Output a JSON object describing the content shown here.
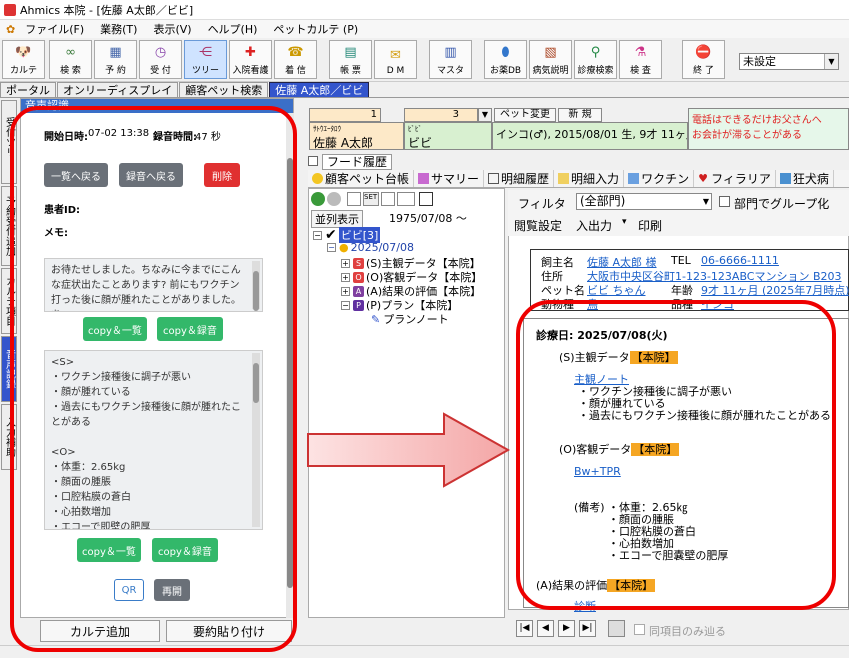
{
  "window": {
    "title": "Ahmics 本院 - [佐藤 A太郎／ビビ]"
  },
  "menu": [
    "ファイル(F)",
    "業務(T)",
    "表示(V)",
    "ヘルプ(H)",
    "ペットカルテ (P)"
  ],
  "toolbar": {
    "buttons": [
      {
        "label": "カルテ",
        "icon": "dog-face-icon"
      },
      {
        "label": "検 索",
        "icon": "binoculars-icon"
      },
      {
        "label": "予 約",
        "icon": "calendar-icon"
      },
      {
        "label": "受 付",
        "icon": "clock-icon"
      },
      {
        "label": "ツリー",
        "icon": "tree-icon"
      },
      {
        "label": "入院看護",
        "icon": "medical-cross-icon"
      },
      {
        "label": "着 信",
        "icon": "phone-bell-icon"
      },
      {
        "label": "帳 票",
        "icon": "document-icon"
      },
      {
        "label": "D M",
        "icon": "envelope-icon"
      },
      {
        "label": "マスタ",
        "icon": "database-icon"
      },
      {
        "label": "お薬DB",
        "icon": "pill-icon"
      },
      {
        "label": "病気説明",
        "icon": "clipboard-icon"
      },
      {
        "label": "診療検索",
        "icon": "magnifier-icon"
      },
      {
        "label": "検 査",
        "icon": "lab-icon"
      },
      {
        "label": "終 了",
        "icon": "stop-icon"
      }
    ],
    "setting_select": "未設定"
  },
  "tabs": [
    "ポータル",
    "オンリーディスプレイ",
    "顧客ペット検索",
    "佐藤 A太郎／ビビ"
  ],
  "side_tabs": [
    "受付ツリー",
    "予約受付追加",
    "カルテ項目",
    "音声記録",
    "入力補助"
  ],
  "voice_panel": {
    "header": "音声認識",
    "start_label": "開始日時:",
    "start_value": "07-02 13:38",
    "duration_label": "録音時間:",
    "duration_value": "47 秒",
    "btn_back_list": "一覧へ戻る",
    "btn_back_rec": "録音へ戻る",
    "btn_delete": "削除",
    "patient_id_label": "患者ID:",
    "memo_label": "メモ:",
    "transcript": "お待たせしました。ちなみに今までにこんな症状出たことあります? 前にもワクチン打った後に顔が腫れたことがありました。あ",
    "btn_copy_list": "copy＆一覧",
    "btn_copy_rec": "copy＆録音",
    "soap_lines": [
      "<S>",
      "・ワクチン接種後に調子が悪い",
      "・顔が腫れている",
      "・過去にもワクチン接種後に顔が腫れたことがある",
      "",
      "<O>",
      "・体重：2.65kg",
      "・顔面の腫脹",
      "・口腔粘膜の蒼白",
      "・心拍数増加",
      "・エコーで即壁の肥厚"
    ],
    "btn_copy_list2": "copy＆一覧",
    "btn_copy_rec2": "copy＆録音",
    "btn_qr": "QR",
    "btn_resume": "再開",
    "btn_add_karte": "カルテ追加",
    "btn_paste_summary": "要約貼り付け"
  },
  "patient": {
    "num1": "1",
    "num3": "3",
    "pet_change": "ペット変更",
    "new": "新 規",
    "kana_owner": "ｻﾄｳｴｰﾀﾛｳ",
    "owner": "佐藤 A太郎",
    "kana_pet": "ﾋﾞﾋﾞ",
    "pet": "ビビ",
    "pet_info": "インコ(♂), 2015/08/01 生, 9才 11ヶ月",
    "note_line1": "電話はできるだけお父さんへ",
    "note_line2": "お会計が滞ることがある"
  },
  "nav_title": "フード履歴",
  "subtabs": [
    "顧客ペット台帳",
    "サマリー",
    "明細履歴",
    "明細入力",
    "ワクチン",
    "フィラリア",
    "狂犬病"
  ],
  "tree": {
    "mode": "並列表示",
    "date_filter": "1975/07/08 〜",
    "root": "ビビ[3]",
    "date": "2025/07/08",
    "items": [
      {
        "tag": "S",
        "label": "(S)主観データ【本院】",
        "color": "#e04040"
      },
      {
        "tag": "O",
        "label": "(O)客観データ【本院】",
        "color": "#e04040"
      },
      {
        "tag": "A",
        "label": "(A)結果の評価【本院】",
        "color": "#8040a0"
      },
      {
        "tag": "P",
        "label": "(P)プラン【本院】",
        "color": "#6030a0"
      }
    ],
    "plan_note": "プランノート"
  },
  "report": {
    "filter_label": "フィルタ",
    "filter_value": "(全部門)",
    "group_label": "部門でグループ化",
    "menu": [
      "閲覧設定",
      "入出力",
      "印刷"
    ],
    "owner_label": "飼主名",
    "owner_value": "佐藤 A太郎 様",
    "tel_label": "TEL",
    "tel_value": "06-6666-1111",
    "addr_label": "住所",
    "addr_value": "大阪市中央区谷町1-123-123ABCマンション B203",
    "pet_label": "ペット名",
    "pet_value": "ビビ ちゃん",
    "age_label": "年齢",
    "age_value": "9才 11ヶ月 (2025年7月時点)",
    "species_label": "動物種",
    "species_value": "鳥",
    "breed_label": "品種",
    "breed_value": "インコ",
    "visit": "診療日: 2025/07/08(火)",
    "s_title": "(S)主観データ",
    "s_badge": "【本院】",
    "s_link": "主観ノート",
    "s_lines": [
      "・ワクチン接種後に調子が悪い",
      "・顔が腫れている",
      "・過去にもワクチン接種後に顔が腫れたことがある"
    ],
    "o_title": "(O)客観データ",
    "o_badge": "【本院】",
    "o_link": "Bw+TPR",
    "o_note_label": "(備考)",
    "o_lines": [
      "・体重：2.65㎏",
      "・顔面の腫脹",
      "・口腔粘膜の蒼白",
      "・心拍数増加",
      "・エコーで胆嚢壁の肥厚"
    ],
    "a_title": "(A)結果の評価",
    "a_badge": "【本院】",
    "a_link": "診断"
  },
  "navbar": {
    "same_item": "同項目のみ辿る"
  }
}
